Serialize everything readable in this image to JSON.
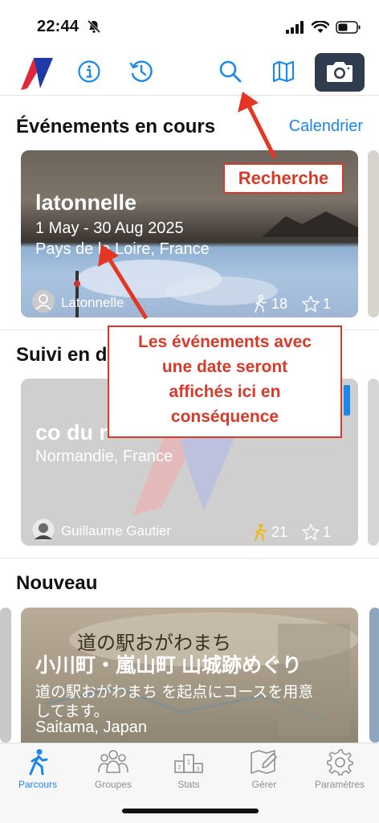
{
  "status": {
    "time": "22:44"
  },
  "sections": {
    "current": {
      "title": "Événements en cours",
      "link": "Calendrier"
    },
    "followed": {
      "title": "Suivi en d"
    },
    "new": {
      "title": "Nouveau"
    }
  },
  "cards": {
    "event": {
      "title": "latonnelle",
      "dates": "1 May - 30 Aug 2025",
      "location": "Pays de la Loire, France",
      "author": "Latonnelle",
      "walkers": "18",
      "stars": "1"
    },
    "followed": {
      "title": "co du r",
      "location": "Normandie, France",
      "author": "Guillaume Gautier",
      "walkers": "21",
      "stars": "1"
    },
    "new": {
      "title": "小川町・嵐山町 山城跡めぐり",
      "desc_line1": "道の駅おがわまち を起点にコースを用意",
      "desc_line2": "してます。",
      "location": "Saitama, Japan",
      "sign_text": "道の駅おがわまち"
    }
  },
  "annotations": {
    "search": "Recherche",
    "events_line1": "Les événements avec",
    "events_line2": "une date seront",
    "events_line3": "affichés ici en",
    "events_line4": "conséquence"
  },
  "tabs": [
    {
      "label": "Parcours",
      "icon": "hiker-icon",
      "active": true
    },
    {
      "label": "Groupes",
      "icon": "group-icon",
      "active": false
    },
    {
      "label": "Stats",
      "icon": "podium-icon",
      "active": false
    },
    {
      "label": "Gérer",
      "icon": "edit-map-icon",
      "active": false
    },
    {
      "label": "Paramètres",
      "icon": "gear-icon",
      "active": false
    }
  ],
  "colors": {
    "accent": "#1a88e8",
    "annotation": "#d83a2a",
    "camera_button": "#2f3c4d",
    "walker_followed": "#f2b705"
  }
}
